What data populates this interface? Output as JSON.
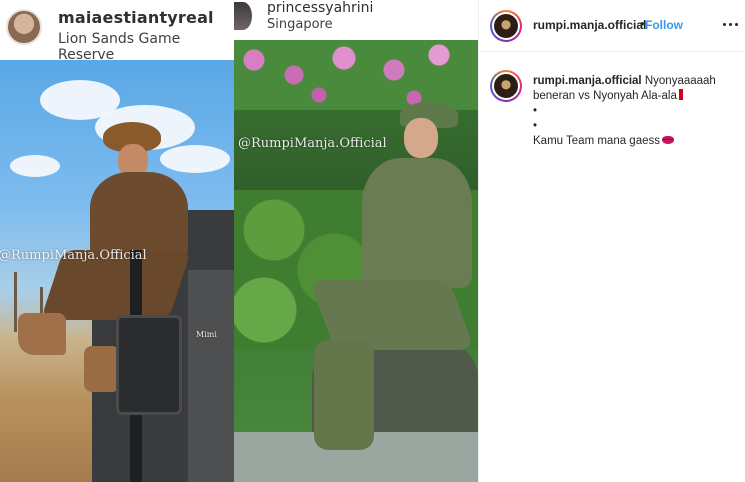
{
  "media": {
    "left": {
      "username": "maiaestiantyreal",
      "location": "Lion Sands Game Reserve",
      "watermark": "@RumpiManja.Official",
      "watermark_small": "Mimi"
    },
    "right": {
      "username": "princessyahrini",
      "location": "Singapore",
      "watermark": "@RumpiManja.Official"
    }
  },
  "post": {
    "author": "rumpi.manja.official",
    "separator": "•",
    "follow_label": "Follow",
    "more_icon": "ellipsis-icon",
    "accent_color": "#3897f0"
  },
  "caption": {
    "author": "rumpi.manja.official",
    "line1": "Nyonyaaaaah beneran vs Nyonyah Ala-ala",
    "bullet1": "•",
    "bullet2": "•",
    "line2": "Kamu Team mana gaess",
    "emoji1": "exclamation-icon",
    "emoji2": "lips-icon"
  }
}
